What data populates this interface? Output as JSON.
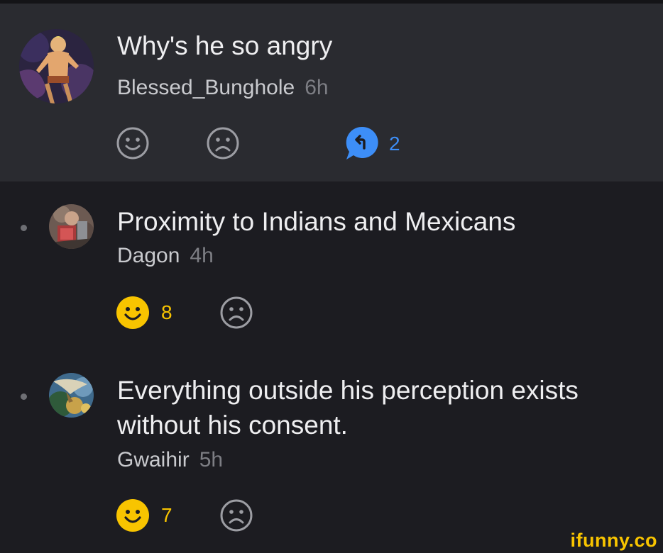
{
  "parent": {
    "text": "Why's he so angry",
    "username": "Blessed_Bunghole",
    "time": "6h",
    "reply_count": "2"
  },
  "replies": [
    {
      "lines": [
        "Proximity to Indians and Mexicans"
      ],
      "username": "Dagon",
      "time": "4h",
      "smile_count": "8"
    },
    {
      "lines": [
        "Everything outside his perception exists",
        "without his consent."
      ],
      "username": "Gwaihir",
      "time": "5h",
      "smile_count": "7"
    }
  ],
  "watermark": "ifunny.co",
  "colors": {
    "accent_yellow": "#f8c400",
    "reply_blue": "#3d8ef7",
    "icon_gray": "#9c9da3",
    "parent_bg": "#2a2b30",
    "bg": "#1c1c21"
  }
}
